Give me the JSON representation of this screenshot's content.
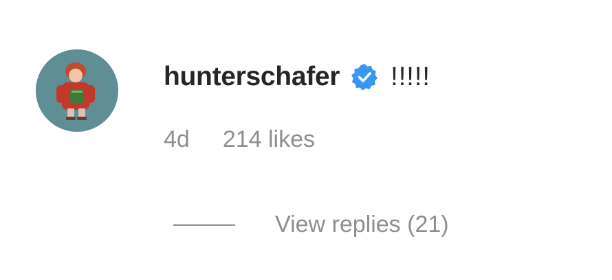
{
  "comment": {
    "avatar_icon": "user-avatar",
    "username": "hunterschafer",
    "verified_icon": "verified-badge-icon",
    "verified_color": "#3897f0",
    "text": "!!!!!",
    "timestamp": "4d",
    "likes": "214 likes",
    "view_replies": "View replies (21)"
  }
}
